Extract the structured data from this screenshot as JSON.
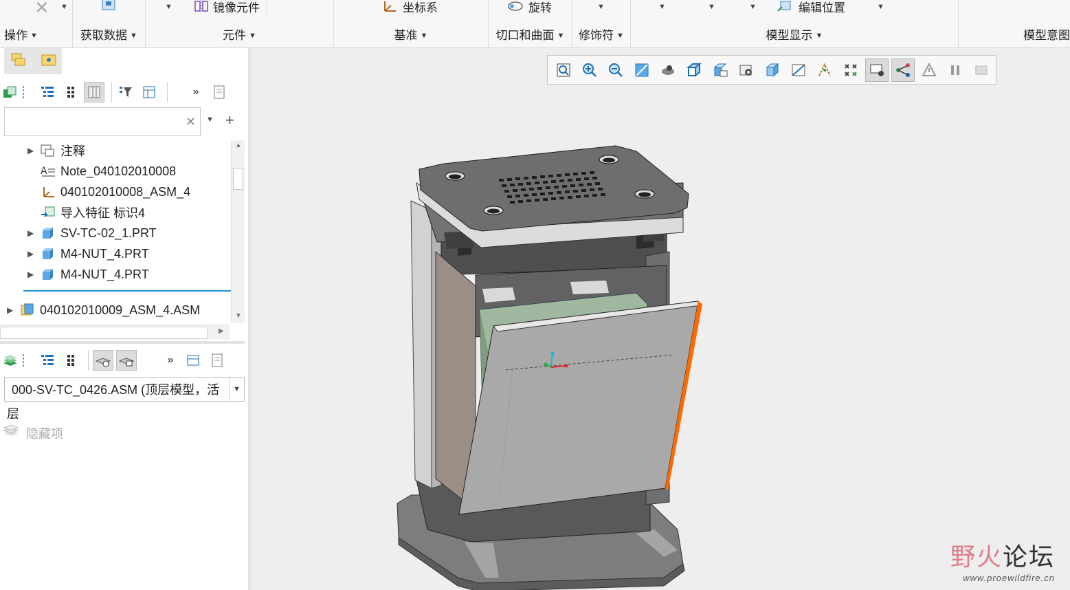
{
  "ribbon": {
    "groups": [
      {
        "label": "操作"
      },
      {
        "label": "获取数据"
      },
      {
        "label": "元件"
      },
      {
        "label": "基准"
      },
      {
        "label": "切口和曲面"
      },
      {
        "label": "修饰符"
      },
      {
        "label": "模型显示"
      },
      {
        "label": "模型意图"
      }
    ],
    "items": {
      "mirror": "镜像元件",
      "csys": "坐标系",
      "revolve": "旋转",
      "edit_position": "编辑位置"
    }
  },
  "model_tree": {
    "search_placeholder": "",
    "items": [
      {
        "label": "注释",
        "icon": "annotation-folder-icon"
      },
      {
        "label": "Note_040102010008",
        "icon": "note-icon"
      },
      {
        "label": "040102010008_ASM_4",
        "icon": "csys-icon"
      },
      {
        "label": "导入特征 标识4",
        "icon": "import-feature-icon"
      },
      {
        "label": "SV-TC-02_1.PRT",
        "icon": "part-icon"
      },
      {
        "label": "M4-NUT_4.PRT",
        "icon": "part-icon"
      },
      {
        "label": "M4-NUT_4.PRT",
        "icon": "part-icon"
      },
      {
        "label": "040102010009_ASM_4.ASM",
        "icon": "assembly-icon"
      }
    ]
  },
  "layers": {
    "selected_model": "000-SV-TC_0426.ASM (顶层模型，活",
    "header": "层",
    "hidden_item": "隐藏项"
  },
  "watermark": {
    "title_a": "野火",
    "title_b": "论坛",
    "url": "www.proewildfire.cn"
  },
  "colors": {
    "accent": "#1f8fd6",
    "part_blue": "#5aa9e6",
    "highlight_edge": "#ff6a00"
  }
}
